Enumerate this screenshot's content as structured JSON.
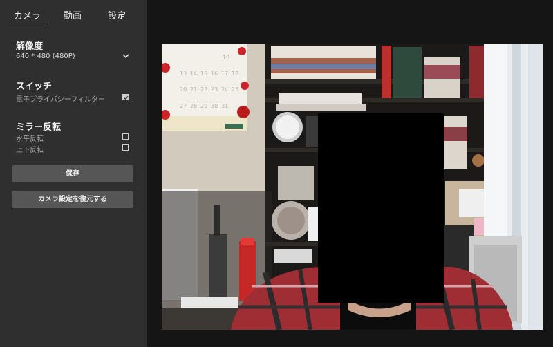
{
  "tabs": [
    {
      "label": "カメラ"
    },
    {
      "label": "動画"
    },
    {
      "label": "設定"
    }
  ],
  "resolution": {
    "title": "解像度",
    "value": "640 * 480 (480P)"
  },
  "switch": {
    "title": "スイッチ",
    "privacy_filter": {
      "label": "電子プライバシーフィルター",
      "checked": true
    }
  },
  "mirror": {
    "title": "ミラー反転",
    "horizontal": {
      "label": "水平反転",
      "checked": false
    },
    "vertical": {
      "label": "上下反転",
      "checked": false
    }
  },
  "buttons": {
    "save": "保存",
    "restore": "カメラ設定を復元する"
  },
  "calendar": {
    "rows": [
      [
        "",
        "",
        "",
        "",
        "10",
        ""
      ],
      [
        "13",
        "14",
        "15",
        "16",
        "17",
        "18"
      ],
      [
        "20",
        "21",
        "22",
        "23",
        "24",
        "25"
      ],
      [
        "27",
        "28",
        "29",
        "30",
        "31",
        ""
      ]
    ]
  }
}
